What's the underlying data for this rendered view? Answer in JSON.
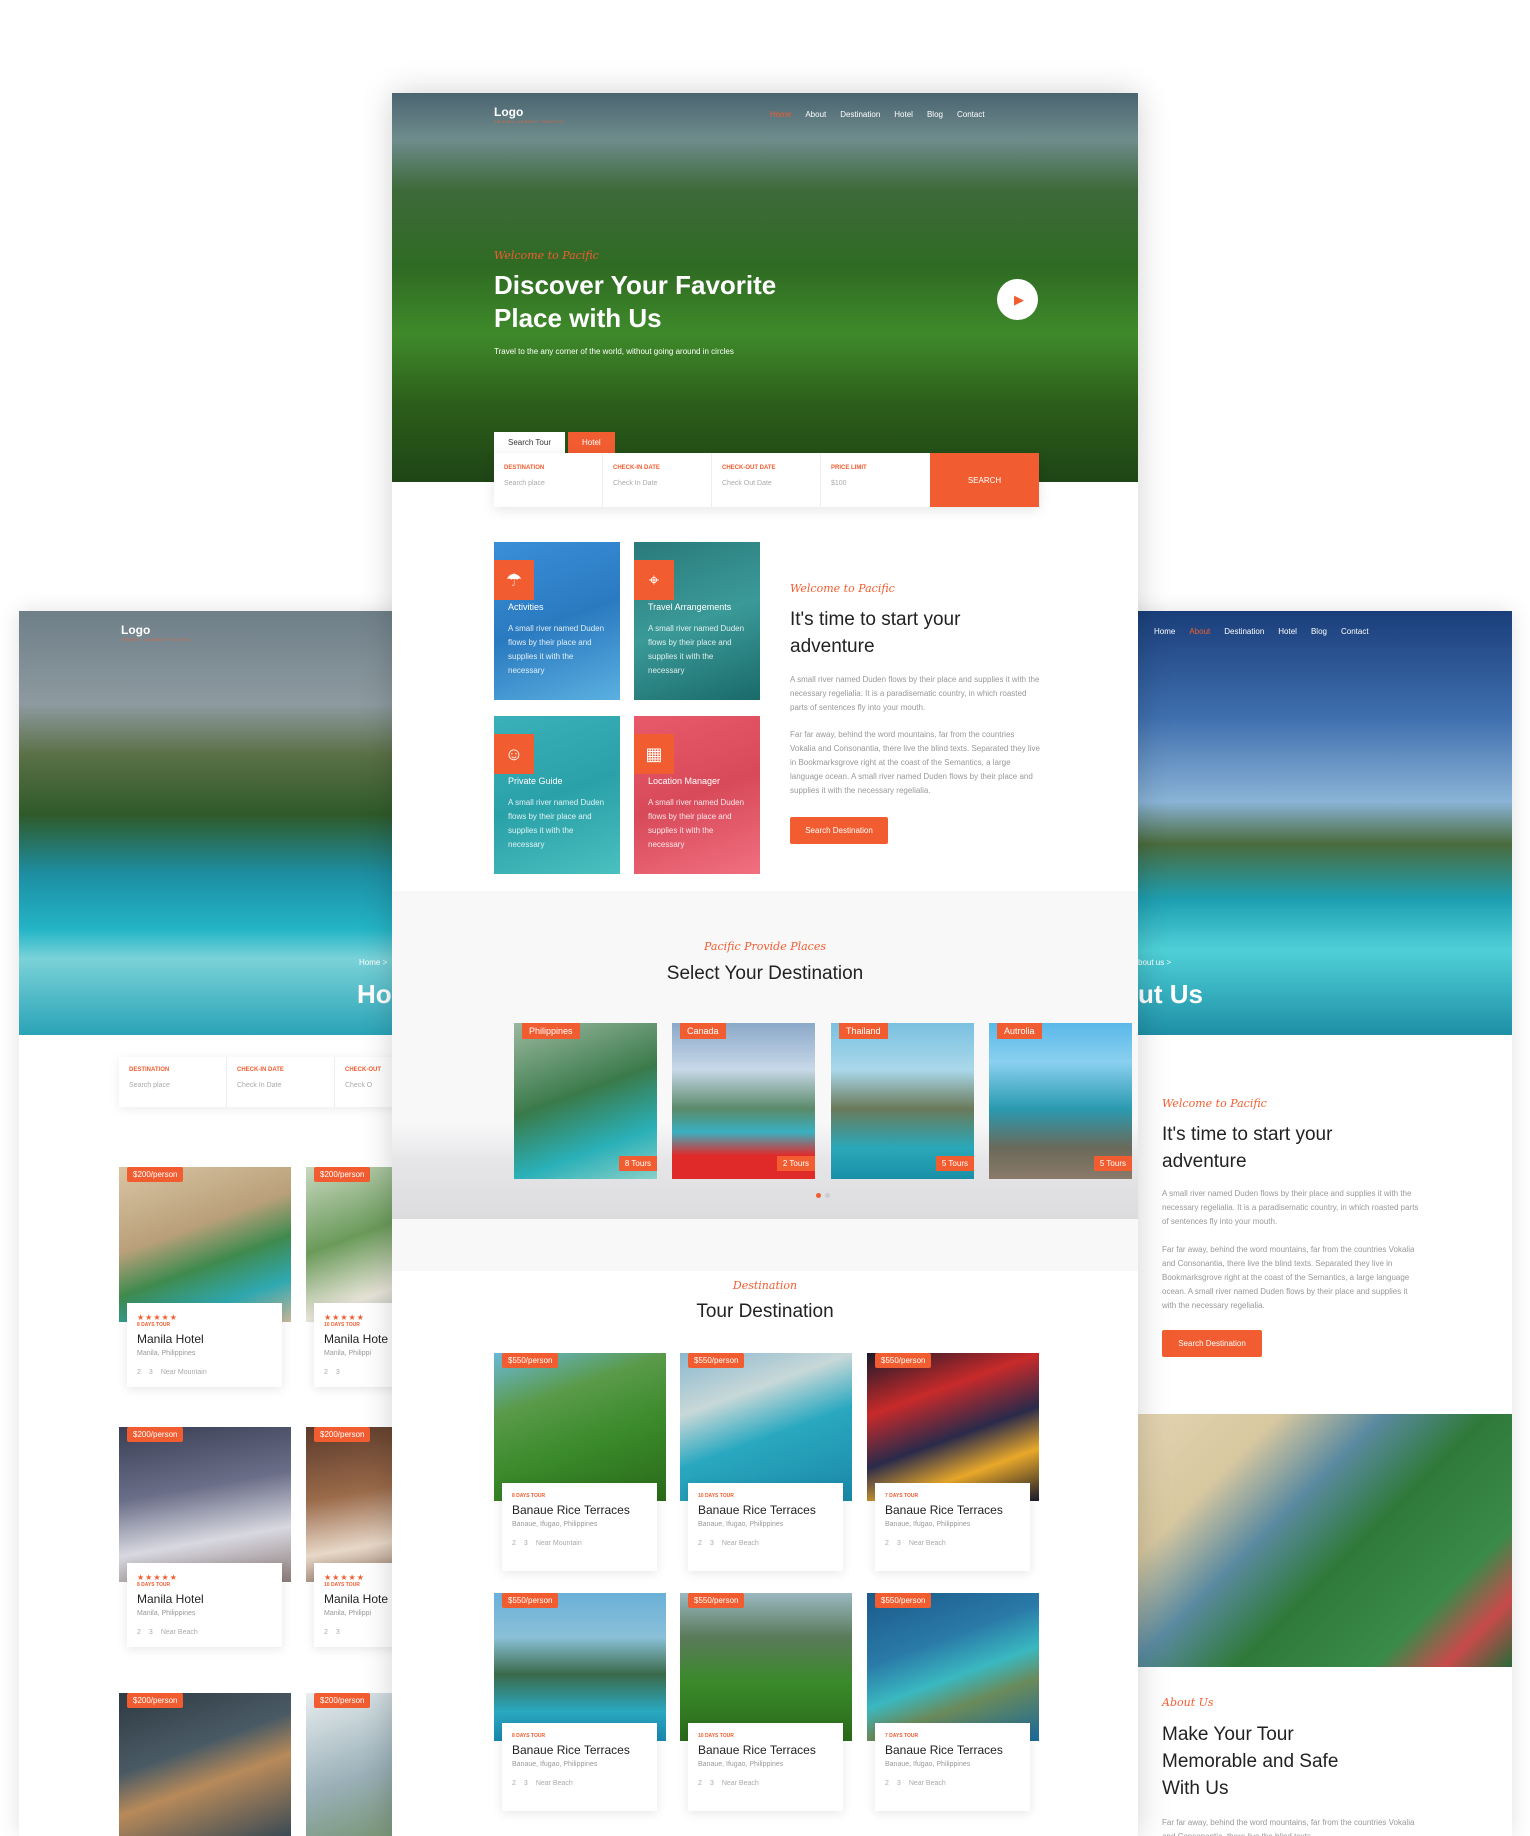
{
  "center": {
    "logo": "Logo",
    "logo_sub": "TRAVEL AGENCY PACIFIC",
    "nav": [
      "Home",
      "About",
      "Destination",
      "Hotel",
      "Blog",
      "Contact"
    ],
    "hero_kicker": "Welcome to Pacific",
    "hero_title_1": "Discover Your Favorite",
    "hero_title_2": "Place with Us",
    "hero_subtitle": "Travel to the any corner of the world, without going around in circles",
    "tabs": [
      "Search Tour",
      "Hotel"
    ],
    "fields": [
      {
        "label": "DESTINATION",
        "value": "Search place"
      },
      {
        "label": "CHECK-IN DATE",
        "value": "Check In Date"
      },
      {
        "label": "CHECK-OUT DATE",
        "value": "Check Out Date"
      },
      {
        "label": "PRICE LIMIT",
        "value": "$100"
      }
    ],
    "search_btn": "SEARCH",
    "services": [
      {
        "title": "Activities",
        "desc": "A small river named Duden flows by their place and supplies it with the necessary"
      },
      {
        "title": "Travel Arrangements",
        "desc": "A small river named Duden flows by their place and supplies it with the necessary"
      },
      {
        "title": "Private Guide",
        "desc": "A small river named Duden flows by their place and supplies it with the necessary"
      },
      {
        "title": "Location Manager",
        "desc": "A small river named Duden flows by their place and supplies it with the necessary"
      }
    ],
    "about_kicker": "Welcome to Pacific",
    "about_title_1": "It's time to start your",
    "about_title_2": "adventure",
    "about_p1": "A small river named Duden flows by their place and supplies it with the necessary regelialia. It is a paradisematic country, in which roasted parts of sentences fly into your mouth.",
    "about_p2": "Far far away, behind the word mountains, far from the countries Vokalia and Consonantia, there live the blind texts. Separated they live in Bookmarksgrove right at the coast of the Semantics, a large language ocean. A small river named Duden flows by their place and supplies it with the necessary regelialia.",
    "about_btn": "Search Destination",
    "places_kicker": "Pacific Provide Places",
    "places_title": "Select Your Destination",
    "places": [
      {
        "name": "Philippines",
        "tours": "8 Tours"
      },
      {
        "name": "Canada",
        "tours": "2 Tours"
      },
      {
        "name": "Thailand",
        "tours": "5 Tours"
      },
      {
        "name": "Autrolia",
        "tours": "5 Tours"
      }
    ],
    "tour_kicker": "Destination",
    "tour_title": "Tour Destination",
    "tours": [
      {
        "price": "$550/person",
        "days": "8 DAYS TOUR",
        "title": "Banaue Rice Terraces",
        "loc": "Banaue, Ifugao, Philippines",
        "a": "2",
        "b": "3",
        "near": "Near Mountain"
      },
      {
        "price": "$550/person",
        "days": "10 DAYS TOUR",
        "title": "Banaue Rice Terraces",
        "loc": "Banaue, Ifugao, Philippines",
        "a": "2",
        "b": "3",
        "near": "Near Beach"
      },
      {
        "price": "$550/person",
        "days": "7 DAYS TOUR",
        "title": "Banaue Rice Terraces",
        "loc": "Banaue, Ifugao, Philippines",
        "a": "2",
        "b": "3",
        "near": "Near Beach"
      },
      {
        "price": "$550/person",
        "days": "8 DAYS TOUR",
        "title": "Banaue Rice Terraces",
        "loc": "Banaue, Ifugao, Philippines",
        "a": "2",
        "b": "3",
        "near": "Near Beach"
      },
      {
        "price": "$550/person",
        "days": "10 DAYS TOUR",
        "title": "Banaue Rice Terraces",
        "loc": "Banaue, Ifugao, Philippines",
        "a": "2",
        "b": "3",
        "near": "Near Beach"
      },
      {
        "price": "$550/person",
        "days": "7 DAYS TOUR",
        "title": "Banaue Rice Terraces",
        "loc": "Banaue, Ifugao, Philippines",
        "a": "2",
        "b": "3",
        "near": "Near Beach"
      }
    ]
  },
  "left": {
    "logo": "Logo",
    "logo_sub": "TRAVEL AGENCY PACIFIC",
    "crumb": "Home >",
    "title": "Ho",
    "fields": [
      {
        "label": "DESTINATION",
        "value": "Search place"
      },
      {
        "label": "CHECK-IN DATE",
        "value": "Check In Date"
      },
      {
        "label": "CHECK-OUT",
        "value": "Check O"
      }
    ],
    "hotels": [
      {
        "price": "$200/person",
        "stars": "★★★★★",
        "days": "8 DAYS TOUR",
        "title": "Manila Hotel",
        "loc": "Manila, Philippines",
        "a": "2",
        "b": "3",
        "near": "Near Mountain"
      },
      {
        "price": "$200/person",
        "stars": "★★★★★",
        "days": "10 DAYS TOUR",
        "title": "Manila Hote",
        "loc": "Manila, Philippi",
        "a": "2",
        "b": "3",
        "near": ""
      },
      {
        "price": "$200/person",
        "stars": "★★★★★",
        "days": "8 DAYS TOUR",
        "title": "Manila Hotel",
        "loc": "Manila, Philippines",
        "a": "2",
        "b": "3",
        "near": "Near Beach"
      },
      {
        "price": "$200/person",
        "stars": "★★★★★",
        "days": "10 DAYS TOUR",
        "title": "Manila Hote",
        "loc": "Manila, Philippi",
        "a": "2",
        "b": "3",
        "near": ""
      },
      {
        "price": "$200/person",
        "stars": "",
        "days": "",
        "title": "",
        "loc": "",
        "a": "",
        "b": "",
        "near": ""
      },
      {
        "price": "$200/person",
        "stars": "",
        "days": "",
        "title": "",
        "loc": "",
        "a": "",
        "b": "",
        "near": ""
      }
    ]
  },
  "right": {
    "nav": [
      "Home",
      "About",
      "Destination",
      "Hotel",
      "Blog",
      "Contact"
    ],
    "crumb": "bout us >",
    "title": "ut Us",
    "about_kicker": "Welcome to Pacific",
    "about_title_1": "It's time to start your",
    "about_title_2": "adventure",
    "about_p1": "A small river named Duden flows by their place and supplies it with the necessary regelialia. It is a paradisematic country, in which roasted parts of sentences fly into your mouth.",
    "about_p2": "Far far away, behind the word mountains, far from the countries Vokalia and Consonantia, there live the blind texts. Separated they live in Bookmarksgrove right at the coast of the Semantics, a large language ocean. A small river named Duden flows by their place and supplies it with the necessary regelialia.",
    "about_btn": "Search Destination",
    "us_kicker": "About Us",
    "us_title_1": "Make Your Tour",
    "us_title_2": "Memorable and Safe",
    "us_title_3": "With Us",
    "us_p": "Far far away, behind the word mountains, far from the countries Vokalia and Consonantia, there live the blind texts"
  },
  "colors": {
    "accent": "#f15d30"
  }
}
